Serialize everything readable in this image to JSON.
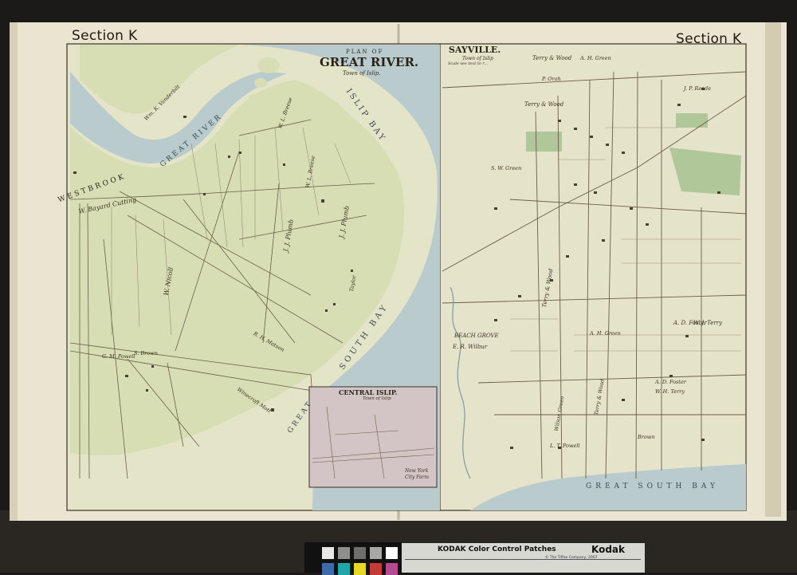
{
  "header": {
    "section_left": "Section K",
    "section_right": "Section K"
  },
  "great_river": {
    "plan_of": "PLAN OF",
    "title": "GREAT RIVER.",
    "subtitle": "Town of Islip.",
    "islip_bay": "ISLIP BAY",
    "great_river_label": "GREAT RIVER",
    "south_bay": "SOUTH BAY",
    "great": "GREAT",
    "westbrook": "WESTBROOK",
    "owners": [
      "Wm. K. Vanderbilt",
      "W. L. Breese",
      "W. Bayard Cutting",
      "W. Nicoll",
      "J. J. Plumb",
      "J. J. Plumb",
      "W. L. Breese",
      "Taylor",
      "G. M. Powell",
      "S. Brown",
      "Winecroft Mott",
      "R. H. Matson"
    ]
  },
  "central_islip": {
    "title": "CENTRAL ISLIP.",
    "subtitle": "Town of Islip",
    "new_york": "New York",
    "city_farm": "City Farm"
  },
  "sayville": {
    "title": "SAYVILLE.",
    "subtitle": "Town of Islip",
    "scale": "Scale see text to r...",
    "great_south_bay": "GREAT SOUTH BAY",
    "beach_grove": "BEACH GROVE",
    "owners": [
      "Terry & Wood",
      "Terry & Wood",
      "Terry & Wood",
      "A. H. Green",
      "P. Orah",
      "E. R. Wilbur",
      "A. D. Foster",
      "W. J. Terry",
      "S. W. Green",
      "J. P. Reade",
      "Wilson Green",
      "Terry & Wood",
      "L. T. Powell",
      "Brown",
      "A. D. Foster",
      "W. H. Terry",
      "A. H. Green"
    ]
  },
  "kodak": {
    "brand": "KODAK Color Control Patches",
    "logo": "Kodak",
    "small_print": "© The Tiffen Company, 2007"
  },
  "colors": {
    "paper": "#ebe7d2",
    "land_green": "#d8e0b6",
    "water_blue": "#b9cbcd",
    "ink": "#2a2418",
    "pink_inset": "#d2c2c6"
  }
}
